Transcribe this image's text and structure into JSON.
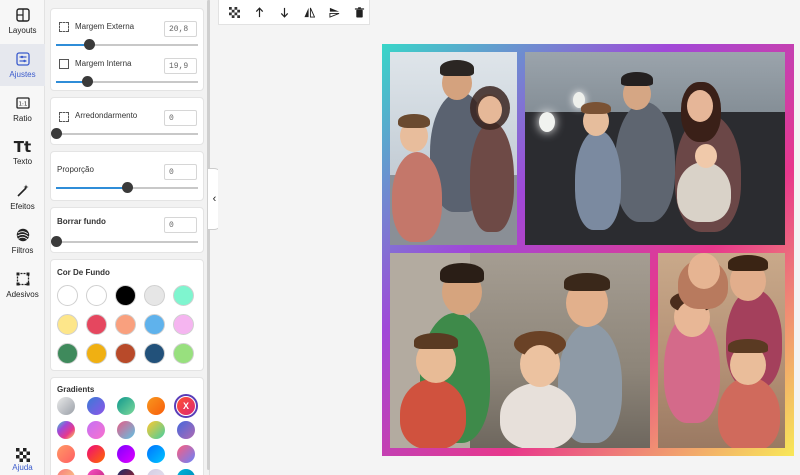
{
  "rail": {
    "items": [
      {
        "label": "Layouts",
        "icon": "layout-icon"
      },
      {
        "label": "Ajustes",
        "icon": "adjust-icon"
      },
      {
        "label": "Ratio",
        "icon": "ratio-icon"
      },
      {
        "label": "Texto",
        "icon": "text-icon",
        "glyph": "Tt"
      },
      {
        "label": "Efeitos",
        "icon": "magic-wand-icon"
      },
      {
        "label": "Filtros",
        "icon": "filter-icon"
      },
      {
        "label": "Adesivos",
        "icon": "sticker-icon"
      },
      {
        "label": "Ajuda",
        "icon": "help-icon"
      }
    ],
    "active": "Ajustes",
    "active_color": "#3b5bcc"
  },
  "panel": {
    "margem_externa": {
      "label": "Margem Externa",
      "value": "20,8",
      "level": 0.23
    },
    "margem_interna": {
      "label": "Margem Interna",
      "value": "19,9",
      "level": 0.22
    },
    "arredondamento": {
      "label": "Arredondarmento",
      "value": "0",
      "level": 0
    },
    "proporcao": {
      "label": "Proporção",
      "value": "0",
      "level": 0.5
    },
    "borrar_fundo": {
      "label": "Borrar fundo",
      "value": "0",
      "level": 0
    },
    "cor_de_fundo": {
      "title": "Cor De Fundo",
      "colors": [
        "#ffffff",
        "#ffffff",
        "#000000",
        "#e6e6e6",
        "#7ff5cf",
        "#fde68a",
        "#e5475f",
        "#f9a07e",
        "#5fb2ec",
        "#f5b5f0",
        "#3f8a5c",
        "#f0b012",
        "#b84a2a",
        "#22517a",
        "#98e07e"
      ]
    },
    "gradients": {
      "title": "Gradients",
      "selected_mark": "X",
      "items": [
        "linear-gradient(135deg,#e9e9e9,#9aa0a8)",
        "linear-gradient(135deg,#3a7bd5,#8e54e9)",
        "linear-gradient(135deg,#11998e,#7dd99a)",
        "linear-gradient(135deg,#f7971e,#f95d0b)",
        "linear-gradient(135deg,#ff512f,#dd2476)",
        "linear-gradient(135deg,#38d6c8,#a048d8,#e8388c,#f8e858)",
        "linear-gradient(135deg,#c471f5,#fa71cd)",
        "linear-gradient(135deg,#e55d87,#5fc3e4)",
        "linear-gradient(135deg,#fdc830,#43cea2)",
        "linear-gradient(135deg,#4568dc,#b06ab3)",
        "linear-gradient(135deg,#ff9966,#ff5e62)",
        "linear-gradient(135deg,#ee0979,#ff6a00)",
        "linear-gradient(135deg,#7f00ff,#e100ff)",
        "linear-gradient(135deg,#0072ff,#00c6ff)",
        "linear-gradient(135deg,#fc5c7d,#6a82fb)",
        "linear-gradient(135deg,#f7797d,#fbd786)",
        "linear-gradient(135deg,#f953c6,#b91d73)",
        "linear-gradient(135deg,#1a2a6c,#b21f1f)",
        "linear-gradient(135deg,#d3cce3,#e9e4f0)",
        "linear-gradient(135deg,#00b4db,#0083b0)"
      ]
    }
  },
  "toolbar": {
    "buttons": [
      {
        "name": "transparency-icon"
      },
      {
        "name": "bring-forward-icon"
      },
      {
        "name": "send-backward-icon"
      },
      {
        "name": "flip-horizontal-icon"
      },
      {
        "name": "flip-vertical-icon"
      },
      {
        "name": "trash-icon"
      }
    ]
  },
  "colors": {
    "slider_fill": "#2f8dd8",
    "collage_gradient": [
      "#38d6c8",
      "#a048d8",
      "#e8388c",
      "#f8e858"
    ]
  }
}
